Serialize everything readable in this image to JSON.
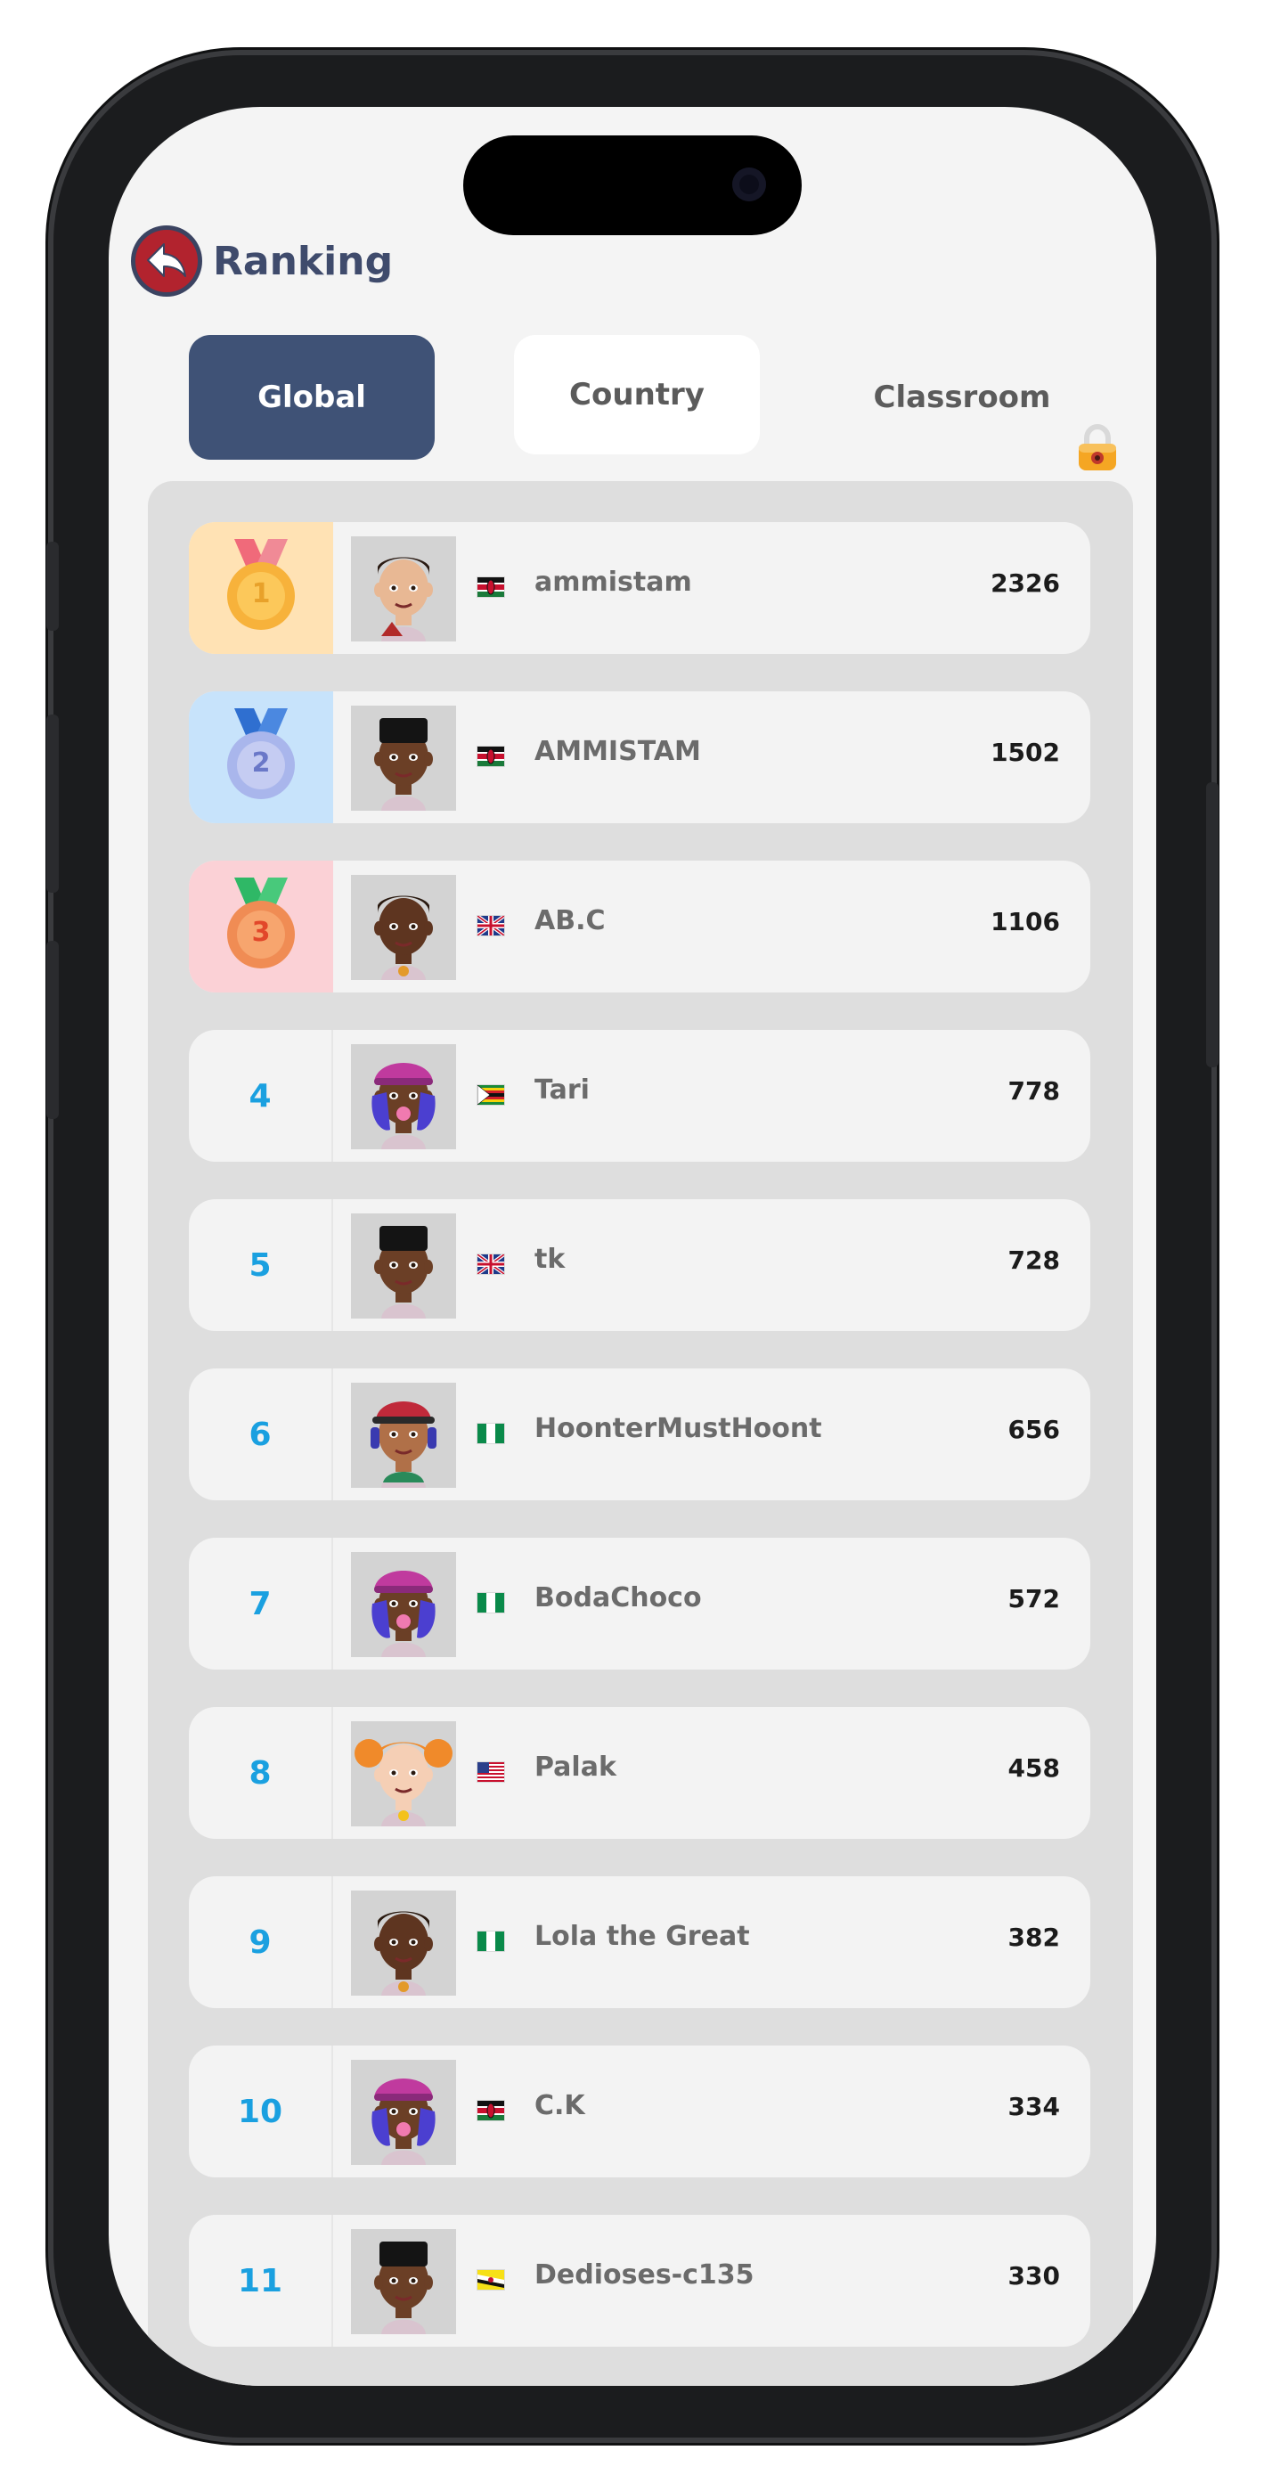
{
  "header": {
    "title": "Ranking",
    "back_icon": "back-arrow-icon"
  },
  "tabs": [
    {
      "label": "Global",
      "state": "active"
    },
    {
      "label": "Country",
      "state": "available"
    },
    {
      "label": "Classroom",
      "state": "locked"
    }
  ],
  "colors": {
    "active_tab": "#3f5276",
    "rank_number": "#1aa0e0",
    "gold_bg": "#ffe2b4",
    "silver_bg": "#c7e3fb",
    "bronze_bg": "#fbd1d6"
  },
  "leaderboard": [
    {
      "rank": "1",
      "medal": "gold",
      "avatar": "boy-curly-hair-avatar",
      "flag": "kenya",
      "name": "ammistam",
      "score": "2326"
    },
    {
      "rank": "2",
      "medal": "silver",
      "avatar": "boy-flat-top-avatar",
      "flag": "kenya",
      "name": "AMMISTAM",
      "score": "1502"
    },
    {
      "rank": "3",
      "medal": "bronze",
      "avatar": "girl-curly-hair-avatar",
      "flag": "uk",
      "name": "AB.C",
      "score": "1106"
    },
    {
      "rank": "4",
      "medal": "",
      "avatar": "girl-cap-blue-hair-avatar",
      "flag": "zimbabwe",
      "name": "Tari",
      "score": "778"
    },
    {
      "rank": "5",
      "medal": "",
      "avatar": "boy-flat-top-avatar",
      "flag": "uk",
      "name": "tk",
      "score": "728"
    },
    {
      "rank": "6",
      "medal": "",
      "avatar": "boy-red-cap-avatar",
      "flag": "nigeria",
      "name": "HoonterMustHoont",
      "score": "656"
    },
    {
      "rank": "7",
      "medal": "",
      "avatar": "girl-cap-blue-hair-avatar",
      "flag": "nigeria",
      "name": "BodaChoco",
      "score": "572"
    },
    {
      "rank": "8",
      "medal": "",
      "avatar": "girl-orange-pigtails-avatar",
      "flag": "usa",
      "name": "Palak",
      "score": "458"
    },
    {
      "rank": "9",
      "medal": "",
      "avatar": "girl-curly-hair-avatar",
      "flag": "nigeria",
      "name": "Lola the Great",
      "score": "382"
    },
    {
      "rank": "10",
      "medal": "",
      "avatar": "girl-cap-blue-hair-avatar",
      "flag": "kenya",
      "name": "C.K",
      "score": "334"
    },
    {
      "rank": "11",
      "medal": "",
      "avatar": "boy-flat-top-avatar",
      "flag": "brunei",
      "name": "Dedioses-c135",
      "score": "330"
    }
  ]
}
